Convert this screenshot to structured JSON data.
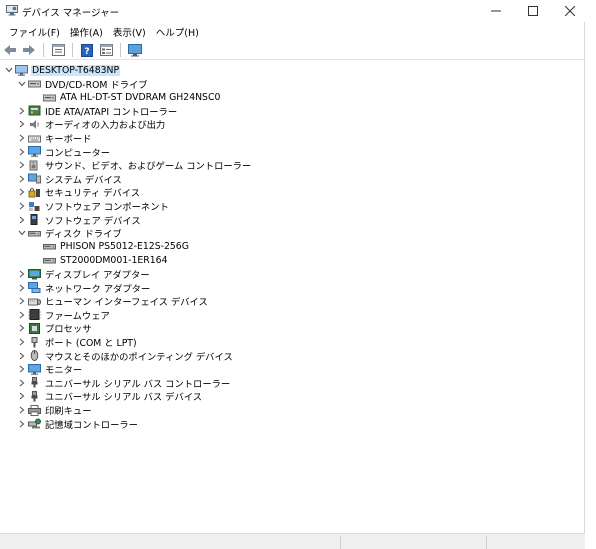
{
  "window": {
    "title": "デバイス マネージャー",
    "controls": {
      "minimize": "—",
      "maximize": "☐",
      "close": "✕"
    }
  },
  "menu": [
    "ファイル(F)",
    "操作(A)",
    "表示(V)",
    "ヘルプ(H)"
  ],
  "toolbar": [
    "back-arrow-icon",
    "forward-arrow-icon",
    "properties-icon",
    "help-icon",
    "view-icon",
    "monitor-scan-icon"
  ],
  "tree": {
    "root": {
      "label": "DESKTOP-T6483NP",
      "expanded": true
    },
    "items": [
      {
        "label": "DVD/CD-ROM ドライブ",
        "icon": "dvd-drive-icon",
        "expanded": true,
        "children": [
          {
            "label": "ATA HL-DT-ST DVDRAM GH24NSC0",
            "icon": "dvd-drive-icon"
          }
        ]
      },
      {
        "label": "IDE ATA/ATAPI コントローラー",
        "icon": "ide-controller-icon",
        "expanded": false
      },
      {
        "label": "オーディオの入力および出力",
        "icon": "audio-icon",
        "expanded": false
      },
      {
        "label": "キーボード",
        "icon": "keyboard-icon",
        "expanded": false
      },
      {
        "label": "コンピューター",
        "icon": "computer-icon",
        "expanded": false
      },
      {
        "label": "サウンド、ビデオ、およびゲーム コントローラー",
        "icon": "sound-icon",
        "expanded": false
      },
      {
        "label": "システム デバイス",
        "icon": "system-device-icon",
        "expanded": false
      },
      {
        "label": "セキュリティ デバイス",
        "icon": "security-device-icon",
        "expanded": false
      },
      {
        "label": "ソフトウェア コンポーネント",
        "icon": "software-component-icon",
        "expanded": false
      },
      {
        "label": "ソフトウェア デバイス",
        "icon": "software-device-icon",
        "expanded": false
      },
      {
        "label": "ディスク ドライブ",
        "icon": "disk-drive-icon",
        "expanded": true,
        "children": [
          {
            "label": "PHISON PS5012-E12S-256G",
            "icon": "disk-drive-icon"
          },
          {
            "label": "ST2000DM001-1ER164",
            "icon": "disk-drive-icon"
          }
        ]
      },
      {
        "label": "ディスプレイ アダプター",
        "icon": "display-adapter-icon",
        "expanded": false
      },
      {
        "label": "ネットワーク アダプター",
        "icon": "network-adapter-icon",
        "expanded": false
      },
      {
        "label": "ヒューマン インターフェイス デバイス",
        "icon": "hid-icon",
        "expanded": false
      },
      {
        "label": "ファームウェア",
        "icon": "firmware-icon",
        "expanded": false
      },
      {
        "label": "プロセッサ",
        "icon": "processor-icon",
        "expanded": false
      },
      {
        "label": "ポート (COM と LPT)",
        "icon": "port-icon",
        "expanded": false
      },
      {
        "label": "マウスとそのほかのポインティング デバイス",
        "icon": "mouse-icon",
        "expanded": false
      },
      {
        "label": "モニター",
        "icon": "monitor-icon",
        "expanded": false
      },
      {
        "label": "ユニバーサル シリアル バス コントローラー",
        "icon": "usb-icon",
        "expanded": false
      },
      {
        "label": "ユニバーサル シリアル バス デバイス",
        "icon": "usb-icon",
        "expanded": false
      },
      {
        "label": "印刷キュー",
        "icon": "printer-icon",
        "expanded": false
      },
      {
        "label": "記憶域コントローラー",
        "icon": "storage-controller-icon",
        "expanded": false
      }
    ]
  }
}
